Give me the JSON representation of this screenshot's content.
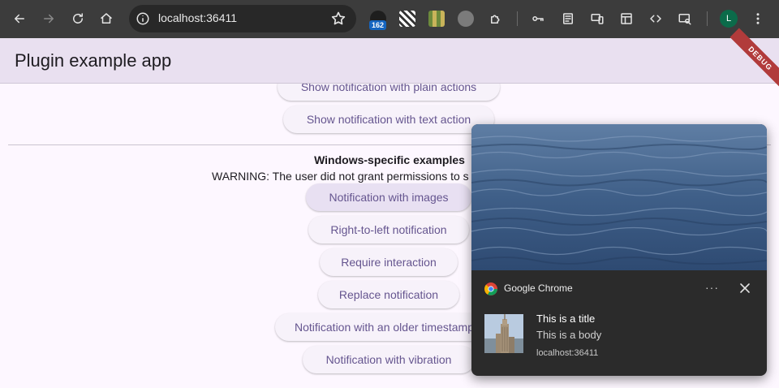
{
  "browser": {
    "url": "localhost:36411",
    "extension_badge": "162",
    "profile_initial": "L"
  },
  "app": {
    "title": "Plugin example app",
    "debug_label": "DEBUG"
  },
  "buttons": {
    "plain_actions": "Show notification with plain actions",
    "text_action": "Show notification with text action",
    "images": "Notification with images",
    "rtl": "Right-to-left notification",
    "require_interaction": "Require interaction",
    "replace": "Replace notification",
    "older_timestamp": "Notification with an older timestamp",
    "vibration": "Notification with vibration"
  },
  "section": {
    "title": "Windows-specific examples",
    "warning": "WARNING: The user did not grant permissions to s"
  },
  "notification": {
    "app_name": "Google Chrome",
    "more_label": "···",
    "title": "This is a title",
    "body": "This is a body",
    "origin": "localhost:36411"
  },
  "colors": {
    "accent": "#65558f",
    "appbar": "#e9e0f0",
    "toolbar": "#3c3c3c",
    "notification_bg": "#2b2b2b"
  }
}
